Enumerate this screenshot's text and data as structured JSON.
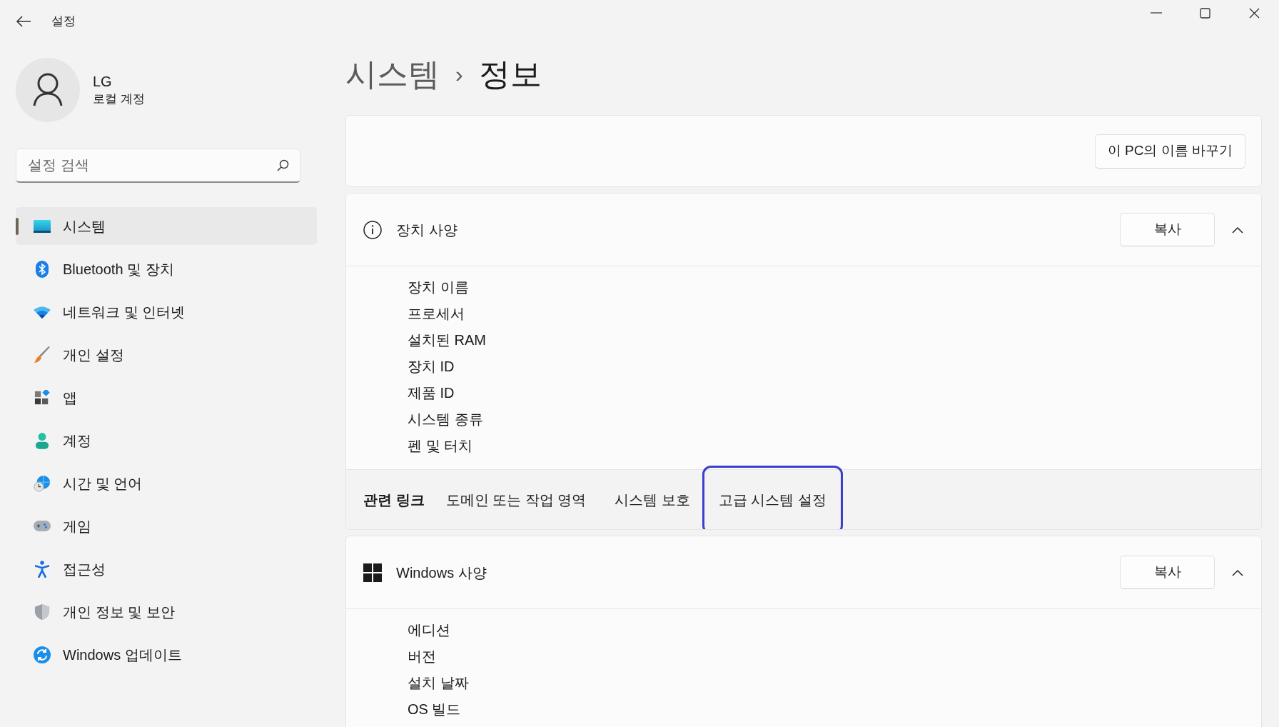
{
  "window": {
    "title": "설정"
  },
  "account": {
    "name": "LG",
    "type": "로컬 계정"
  },
  "search": {
    "placeholder": "설정 검색"
  },
  "sidebar": {
    "items": [
      {
        "label": "시스템",
        "selected": true
      },
      {
        "label": "Bluetooth 및 장치",
        "selected": false
      },
      {
        "label": "네트워크 및 인터넷",
        "selected": false
      },
      {
        "label": "개인 설정",
        "selected": false
      },
      {
        "label": "앱",
        "selected": false
      },
      {
        "label": "계정",
        "selected": false
      },
      {
        "label": "시간 및 언어",
        "selected": false
      },
      {
        "label": "게임",
        "selected": false
      },
      {
        "label": "접근성",
        "selected": false
      },
      {
        "label": "개인 정보 및 보안",
        "selected": false
      },
      {
        "label": "Windows 업데이트",
        "selected": false
      }
    ]
  },
  "breadcrumb": {
    "parent": "시스템",
    "separator": "›",
    "current": "정보"
  },
  "rename_button": "이 PC의 이름 바꾸기",
  "sections": [
    {
      "title": "장치 사양",
      "copy_button": "복사",
      "expanded": true,
      "labels": [
        "장치 이름",
        "프로세서",
        "설치된 RAM",
        "장치 ID",
        "제품 ID",
        "시스템 종류",
        "펜 및 터치"
      ],
      "related": {
        "title": "관련 링크",
        "links": [
          {
            "label": "도메인 또는 작업 영역",
            "highlighted": false
          },
          {
            "label": "시스템 보호",
            "highlighted": false
          },
          {
            "label": "고급 시스템 설정",
            "highlighted": true
          }
        ]
      }
    },
    {
      "title": "Windows 사양",
      "copy_button": "복사",
      "expanded": true,
      "labels": [
        "에디션",
        "버전",
        "설치 날짜",
        "OS 빌드"
      ]
    }
  ]
}
